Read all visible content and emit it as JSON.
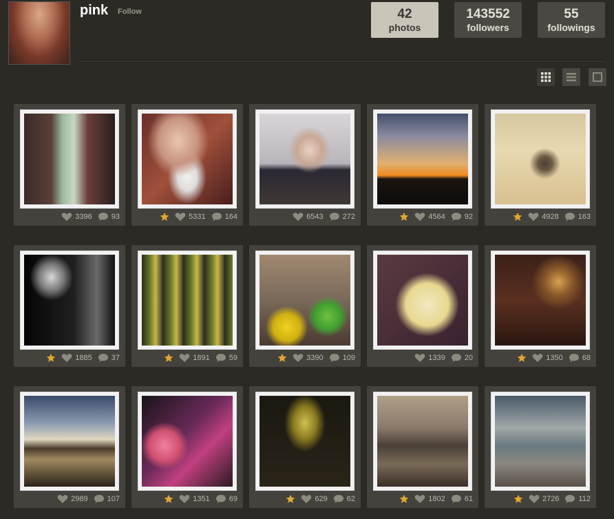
{
  "profile": {
    "username": "pink",
    "follow_label": "Follow"
  },
  "stats": [
    {
      "number": "42",
      "label": "photos",
      "active": true
    },
    {
      "number": "143552",
      "label": "followers",
      "active": false
    },
    {
      "number": "55",
      "label": "followings",
      "active": false
    }
  ],
  "view_modes": [
    "grid-view-icon",
    "list-view-icon",
    "single-view-icon"
  ],
  "photos": [
    {
      "likes": "3396",
      "comments": "93",
      "starred": false,
      "theme": "door"
    },
    {
      "likes": "5331",
      "comments": "164",
      "starred": true,
      "theme": "feet"
    },
    {
      "likes": "6543",
      "comments": "272",
      "starred": false,
      "theme": "baby"
    },
    {
      "likes": "4564",
      "comments": "92",
      "starred": true,
      "theme": "sunset"
    },
    {
      "likes": "4928",
      "comments": "163",
      "starred": true,
      "theme": "beach"
    },
    {
      "likes": "1885",
      "comments": "37",
      "starred": true,
      "theme": "silhouette"
    },
    {
      "likes": "1891",
      "comments": "59",
      "starred": true,
      "theme": "toys"
    },
    {
      "likes": "3390",
      "comments": "109",
      "starred": true,
      "theme": "balloons"
    },
    {
      "likes": "1339",
      "comments": "20",
      "starred": false,
      "theme": "sign"
    },
    {
      "likes": "1350",
      "comments": "68",
      "starred": true,
      "theme": "bar"
    },
    {
      "likes": "2989",
      "comments": "107",
      "starred": false,
      "theme": "pier"
    },
    {
      "likes": "1351",
      "comments": "69",
      "starred": true,
      "theme": "bag"
    },
    {
      "likes": "629",
      "comments": "62",
      "starred": true,
      "theme": "oven"
    },
    {
      "likes": "1802",
      "comments": "61",
      "starred": true,
      "theme": "seagull"
    },
    {
      "likes": "2726",
      "comments": "112",
      "starred": true,
      "theme": "ocean"
    }
  ],
  "colors": {
    "background": "#2c2a25",
    "card": "#44423d",
    "star": "#e0a82e",
    "meta_text": "#bdb9ae"
  }
}
